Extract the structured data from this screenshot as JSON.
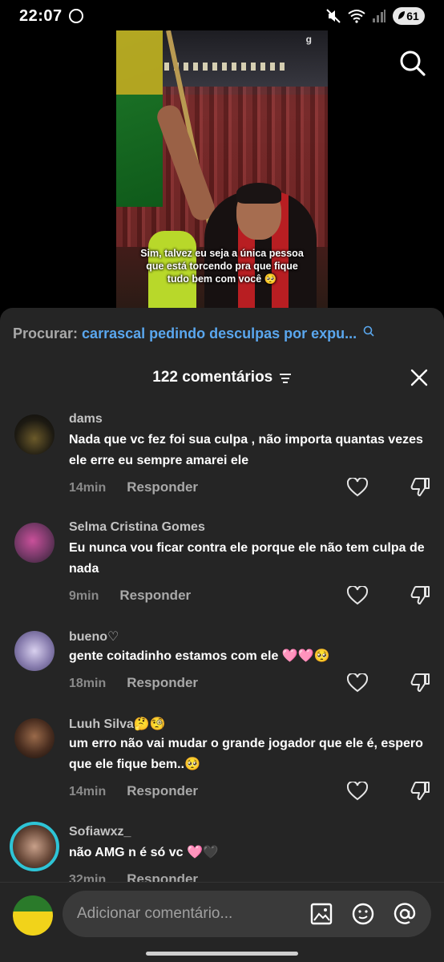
{
  "status_bar": {
    "time": "22:07",
    "battery": "61",
    "icons": [
      "whatsapp-icon",
      "mute-icon",
      "wifi-icon",
      "signal-icon",
      "battery-icon"
    ]
  },
  "video": {
    "watermark": "g",
    "caption_lines": [
      "Sim, talvez eu seja a única pessoa",
      "que está torcendo pra que fique",
      "tudo bem com você 🥺"
    ]
  },
  "search": {
    "label": "Procurar:",
    "term": "carrascal pedindo desculpas por expu..."
  },
  "comments_header": {
    "count_label": "122 comentários"
  },
  "comments": [
    {
      "user": "dams",
      "text": "Nada que vc fez foi sua culpa , não importa quantas vezes ele erre eu sempre amarei ele",
      "time": "14min",
      "reply": "Responder"
    },
    {
      "user": "Selma Cristina Gomes",
      "text": "Eu nunca vou ficar contra ele porque ele não tem culpa de nada",
      "time": "9min",
      "reply": "Responder"
    },
    {
      "user": "bueno♡",
      "text": "gente coitadinho estamos com ele 🩷🩷🥺",
      "time": "18min",
      "reply": "Responder"
    },
    {
      "user": "Luuh Silva🤔🧐",
      "text": "um erro não vai mudar o grande jogador que ele é, espero que ele fique bem..🥺",
      "time": "14min",
      "reply": "Responder"
    },
    {
      "user": "Sofiawxz_",
      "text": "não AMG n é só vc 🩷🖤",
      "time": "32min",
      "reply": "Responder"
    }
  ],
  "composer": {
    "placeholder": "Adicionar comentário..."
  },
  "colors": {
    "sheet_bg": "#252525",
    "accent_link": "#5aa7ee",
    "story_ring": "#2ec4d6"
  }
}
